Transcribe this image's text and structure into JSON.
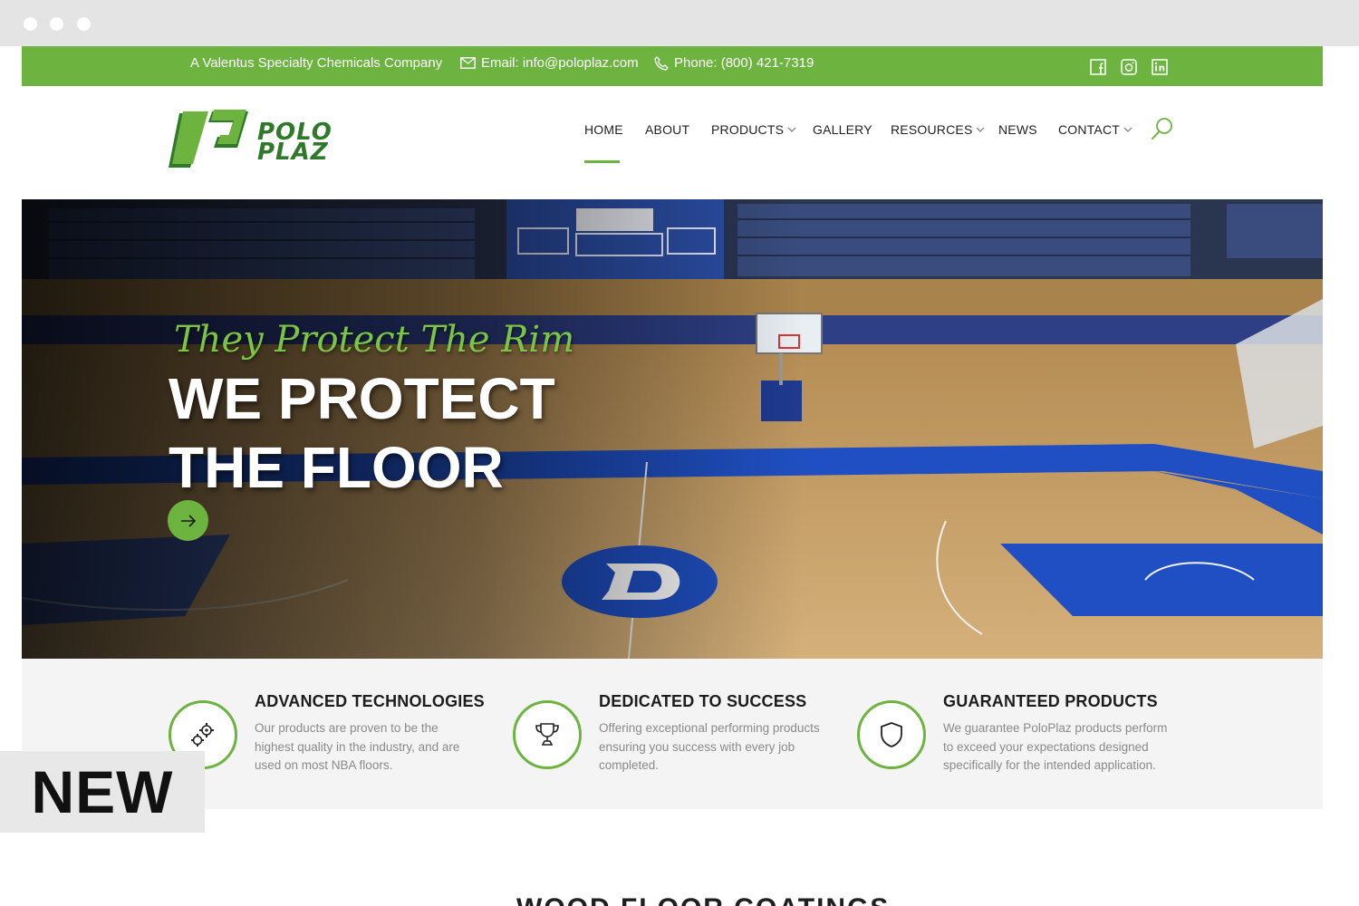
{
  "topbar": {
    "company": "A Valentus Specialty Chemicals Company",
    "email": "Email: info@poloplaz.com",
    "phone": "Phone: (800) 421-7319",
    "social": [
      "facebook-icon",
      "instagram-icon",
      "linkedin-icon"
    ]
  },
  "logo": {
    "line1": "POLO",
    "line2": "PLAZ"
  },
  "nav": {
    "items": [
      {
        "label": "HOME",
        "dropdown": false,
        "active": true
      },
      {
        "label": "ABOUT",
        "dropdown": false
      },
      {
        "label": "PRODUCTS",
        "dropdown": true
      },
      {
        "label": "GALLERY",
        "dropdown": false
      },
      {
        "label": "RESOURCES",
        "dropdown": true
      },
      {
        "label": "NEWS",
        "dropdown": false
      },
      {
        "label": "CONTACT",
        "dropdown": true
      }
    ]
  },
  "hero": {
    "script": "They Protect The Rim",
    "title_line1": "WE PROTECT",
    "title_line2": "THE FLOOR"
  },
  "features": [
    {
      "icon": "gears-icon",
      "title": "ADVANCED TECHNOLOGIES",
      "text": "Our products are proven to be the highest quality in the industry, and are used on most NBA floors."
    },
    {
      "icon": "trophy-icon",
      "title": "DEDICATED TO SUCCESS",
      "text": "Offering exceptional performing products ensuring you success with every job completed."
    },
    {
      "icon": "shield-icon",
      "title": "GUARANTEED PRODUCTS",
      "text": "We guarantee PoloPlaz products perform to exceed your expectations designed specifically for the intended application."
    }
  ],
  "section_heading": "WOOD FLOOR COATINGS",
  "badge": "NEW",
  "colors": {
    "accent": "#6db33f",
    "dark_green": "#2f7a2a"
  }
}
